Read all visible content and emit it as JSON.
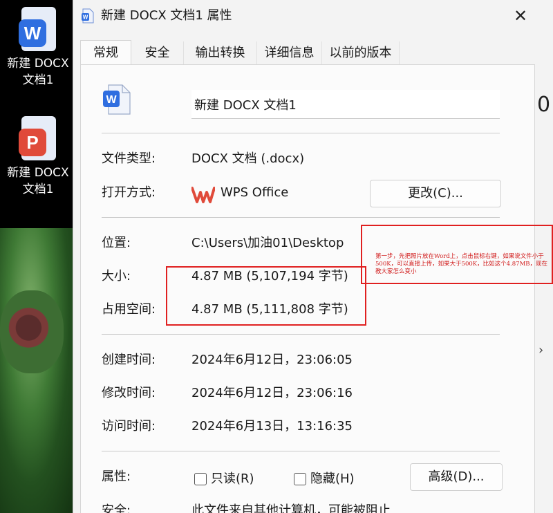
{
  "desktop": {
    "icons": [
      {
        "name_lines": [
          "新建 DOCX",
          "文档1"
        ],
        "badge": "W",
        "color": "#2f6ee0"
      },
      {
        "name_lines": [
          "新建 DOCX",
          "文档1"
        ],
        "badge": "P",
        "color": "#e04a3a"
      }
    ],
    "right_glyph": "0"
  },
  "dialog": {
    "title": "新建 DOCX 文档1 属性",
    "close_label": "✕",
    "tabs": [
      "常规",
      "安全",
      "输出转换",
      "详细信息",
      "以前的版本"
    ],
    "active_tab": "常规",
    "file_name": "新建 DOCX 文档1",
    "rows": {
      "file_type": {
        "label": "文件类型:",
        "value": "DOCX 文档 (.docx)"
      },
      "open_with": {
        "label": "打开方式:",
        "value": "WPS Office",
        "button": "更改(C)..."
      },
      "location": {
        "label": "位置:",
        "value": "C:\\Users\\加油01\\Desktop"
      },
      "size": {
        "label": "大小:",
        "value": "4.87 MB (5,107,194 字节)"
      },
      "disk_size": {
        "label": "占用空间:",
        "value": "4.87 MB (5,111,808 字节)"
      },
      "created": {
        "label": "创建时间:",
        "value": "2024年6月12日，23:06:05"
      },
      "modified": {
        "label": "修改时间:",
        "value": "2024年6月12日，23:06:16"
      },
      "accessed": {
        "label": "访问时间:",
        "value": "2024年6月13日，13:16:35"
      },
      "attributes": {
        "label": "属性:",
        "readonly": "只读(R)",
        "hidden": "隐藏(H)",
        "advanced": "高级(D)..."
      },
      "security": {
        "label": "安全:",
        "value": "此文件来自其他计算机，可能被阻止"
      }
    }
  },
  "annotation": {
    "text": "第一步，先把照片放在Word上，点击鼠标右键，如果说文件小于500K，可以直接上传，如果大于500K，比如这个4.87MB，现在教大家怎么变小"
  },
  "colors": {
    "annotation_red": "#e02020",
    "word_blue": "#2f6ee0",
    "wps_red": "#e04a3a"
  }
}
